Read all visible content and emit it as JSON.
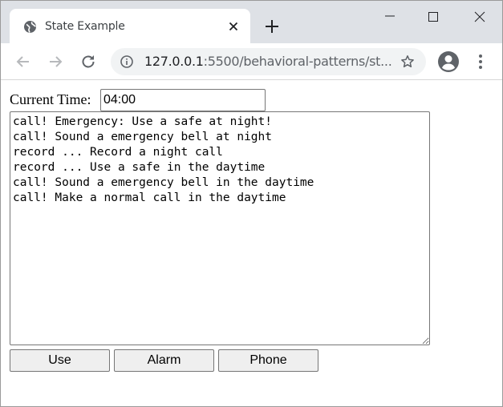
{
  "browser": {
    "tab_title": "State Example",
    "url_host": "127.0.0.1",
    "url_rest": ":5500/behavioral-patterns/st..."
  },
  "page": {
    "time_label": "Current Time:",
    "time_value": "04:00",
    "log_lines": [
      "call! Emergency: Use a safe at night!",
      "call! Sound a emergency bell at night",
      "record ... Record a night call",
      "record ... Use a safe in the daytime",
      "call! Sound a emergency bell in the daytime",
      "call! Make a normal call in the daytime"
    ],
    "buttons": {
      "use": "Use",
      "alarm": "Alarm",
      "phone": "Phone"
    }
  },
  "icons": {
    "favicon": "globe-icon",
    "tab_close": "close-icon",
    "new_tab": "plus-icon",
    "back": "arrow-left-icon",
    "forward": "arrow-right-icon",
    "reload": "reload-icon",
    "site_info": "info-icon",
    "bookmark": "star-icon",
    "profile": "account-icon",
    "menu": "kebab-menu-icon"
  },
  "colors": {
    "tabstrip": "#dee1e6",
    "omnibox": "#f1f3f4",
    "button_face": "#efefef"
  }
}
